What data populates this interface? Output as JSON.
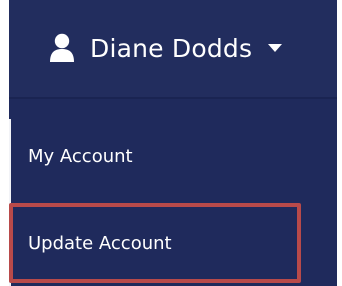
{
  "user_menu": {
    "name": "Diane Dodds",
    "icon": "user-icon",
    "dropdown_icon": "caret-down-icon"
  },
  "menu": {
    "items": [
      {
        "label": "My Account"
      },
      {
        "label": "Update Account"
      }
    ]
  },
  "colors": {
    "background": "#1f2a5c",
    "header": "#222d5e",
    "text": "#ffffff",
    "highlight": "#b84a4a"
  }
}
